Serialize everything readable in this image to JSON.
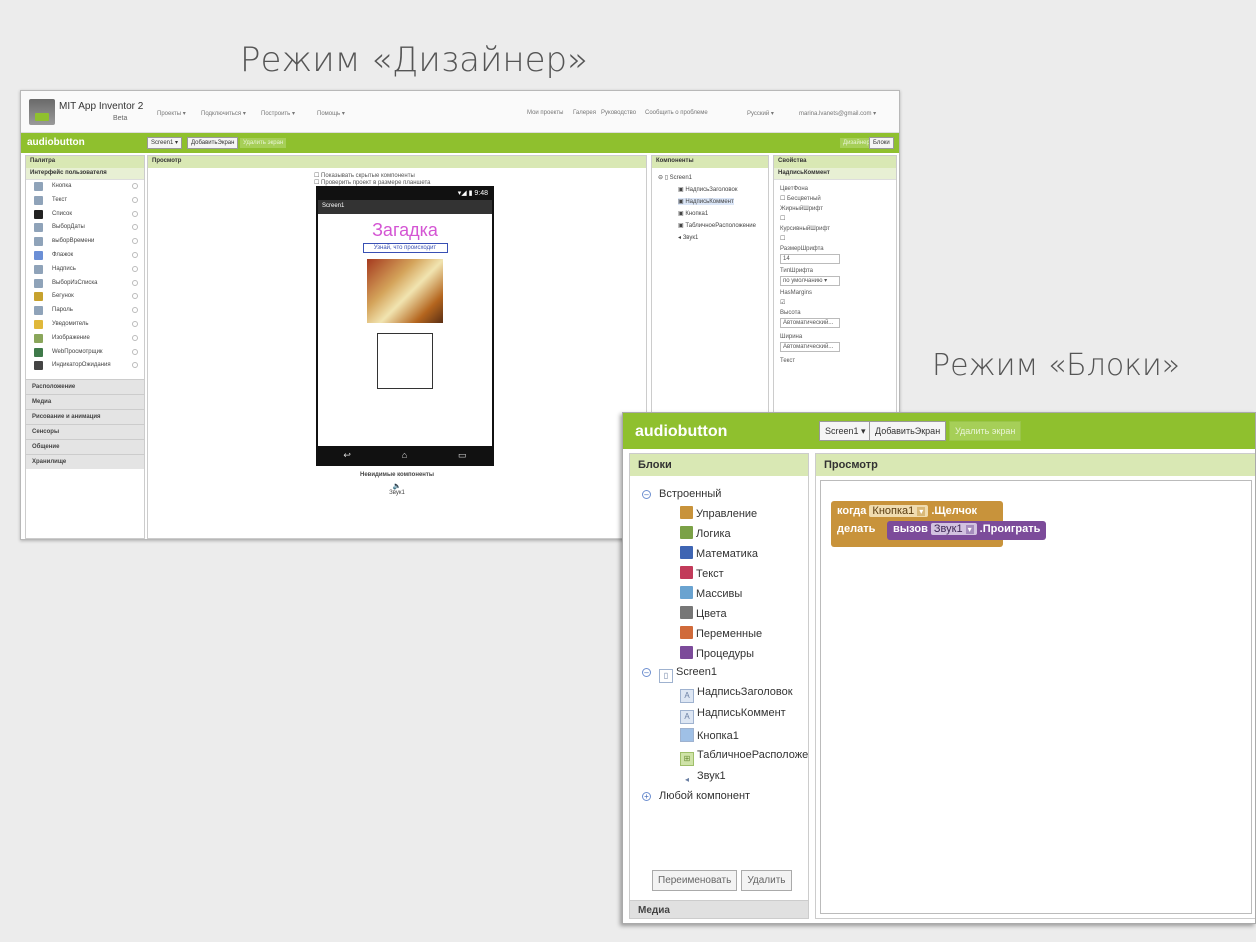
{
  "captions": {
    "designer": "Режим «Дизайнер»",
    "blocks": "Режим «Блоки»"
  },
  "designer": {
    "app_name": "MIT App Inventor 2",
    "beta": "Beta",
    "menu": [
      "Проекты ▾",
      "Подключиться ▾",
      "Построить ▾",
      "Помощь ▾"
    ],
    "menu_right": [
      "Мои проекты",
      "Галерея",
      "Руководство",
      "Сообщить о проблеме",
      "Русский ▾",
      "marina.lvanets@gmail.com ▾"
    ],
    "project": "audiobutton",
    "screen_btn": "Screen1 ▾",
    "add_screen": "ДобавитьЭкран",
    "remove_screen": "Удалить экран",
    "designer_btn": "Дизайнер",
    "blocks_btn": "Блоки",
    "palette_title": "Палитра",
    "palette_section": "Интерфейс пользователя",
    "palette_items": [
      "Кнопка",
      "Текст",
      "Список",
      "ВыборДаты",
      "выборВремени",
      "Флажок",
      "Надпись",
      "ВыборИзСписка",
      "Бегунок",
      "Пароль",
      "Уведомитель",
      "Изображение",
      "WebПросмотрщик",
      "ИндикаторОжидания"
    ],
    "palette_categories": [
      "Расположение",
      "Медиа",
      "Рисование и анимация",
      "Сенсоры",
      "Общение",
      "Хранилище"
    ],
    "viewer_title": "Просмотр",
    "show_hidden": "Показывать скрытые компоненты",
    "check_tablet": "Проверить проект в размере планшета",
    "phone": {
      "time": "9:48",
      "screen": "Screen1",
      "heading": "Загадка",
      "subtitle": "Узнай, что происходит"
    },
    "nonvisible_title": "Невидимые компоненты",
    "nonvisible_item": "Звук1",
    "components_title": "Компоненты",
    "components": [
      "Screen1",
      "НадписьЗаголовок",
      "НадписьКоммент",
      "Кнопка1",
      "ТабличноеРасположение",
      "Звук1"
    ],
    "properties_title": "Свойства",
    "properties_selected": "НадписьКоммент",
    "props": [
      "ЦветФона",
      "Бесцветный",
      "ЖирныйШрифт",
      "КурсивныйШрифт",
      "РазмерШрифта",
      "14",
      "ТипШрифта",
      "по умолчанию ▾",
      "HasMargins",
      "Высота",
      "Автоматический...",
      "Ширина",
      "Автоматический...",
      "Текст"
    ]
  },
  "blocks": {
    "project": "audiobutton",
    "screen_btn": "Screen1 ▾",
    "add_screen": "ДобавитьЭкран",
    "remove_screen": "Удалить экран",
    "left_title": "Блоки",
    "builtin": "Встроенный",
    "categories": [
      {
        "label": "Управление",
        "color": "#c8933b"
      },
      {
        "label": "Логика",
        "color": "#7ba147"
      },
      {
        "label": "Математика",
        "color": "#3f65b3"
      },
      {
        "label": "Текст",
        "color": "#c23b5a"
      },
      {
        "label": "Массивы",
        "color": "#6aa3d0"
      },
      {
        "label": "Цвета",
        "color": "#777777"
      },
      {
        "label": "Переменные",
        "color": "#d06a3a"
      },
      {
        "label": "Процедуры",
        "color": "#7c4b9a"
      }
    ],
    "screen": "Screen1",
    "components": [
      "НадписьЗаголовок",
      "НадписьКоммент",
      "Кнопка1",
      "ТабличноеРасположени",
      "Звук1"
    ],
    "any_component": "Любой компонент",
    "rename": "Переименовать",
    "delete": "Удалить",
    "media": "Медиа",
    "viewer_title": "Просмотр",
    "event": {
      "when": "когда",
      "component": "Кнопка1",
      "event": ".Щелчок",
      "do": "делать"
    },
    "call": {
      "call": "вызов",
      "component": "Звук1",
      "method": ".Проиграть"
    }
  }
}
